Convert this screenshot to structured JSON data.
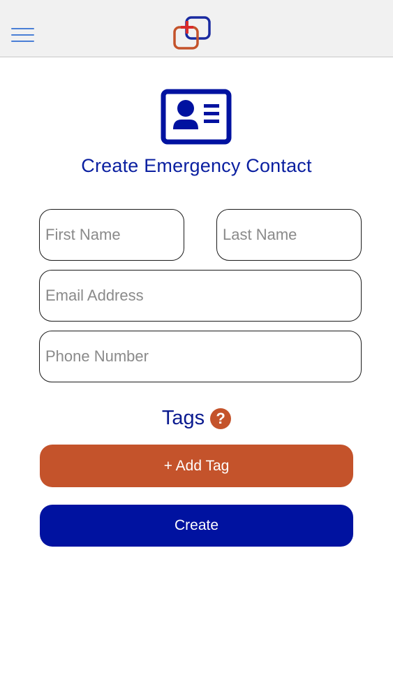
{
  "header": {
    "menu_icon": "hamburger-menu-icon",
    "logo_icon": "app-logo-icon"
  },
  "page": {
    "card_icon": "contact-card-icon",
    "title": "Create Emergency Contact"
  },
  "form": {
    "first_name_placeholder": "First Name",
    "last_name_placeholder": "Last Name",
    "email_placeholder": "Email Address",
    "phone_placeholder": "Phone Number"
  },
  "tags": {
    "label": "Tags",
    "help_symbol": "?"
  },
  "buttons": {
    "add_tag_label": "+ Add Tag",
    "create_label": "Create"
  },
  "colors": {
    "primary": "#0012a0",
    "accent": "#c4532b",
    "menu": "#4a7fd6"
  }
}
